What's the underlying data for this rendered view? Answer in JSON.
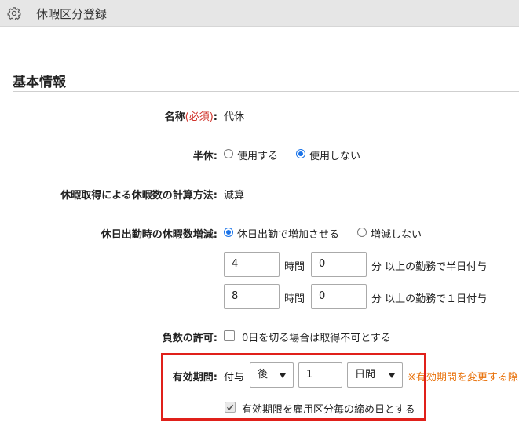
{
  "header": {
    "title": "休暇区分登録",
    "icon": "gear-icon"
  },
  "section": {
    "title": "基本情報"
  },
  "fields": {
    "name": {
      "label": "名称",
      "required": "(必須)",
      "colon": ":",
      "value": "代休"
    },
    "half_day": {
      "label": "半休:",
      "options": [
        {
          "label": "使用する",
          "selected": false
        },
        {
          "label": "使用しない",
          "selected": true
        }
      ]
    },
    "calc_method": {
      "label": "休暇取得による休暇数の計算方法:",
      "value": "減算"
    },
    "holiday_work": {
      "label": "休日出勤時の休暇数増減:",
      "options": [
        {
          "label": "休日出勤で増加させる",
          "selected": true
        },
        {
          "label": "増減しない",
          "selected": false
        }
      ],
      "half_grant": {
        "hours": "4",
        "hours_unit": "時間",
        "minutes": "0",
        "suffix": "分 以上の勤務で半日付与"
      },
      "full_grant": {
        "hours": "8",
        "hours_unit": "時間",
        "minutes": "0",
        "suffix": "分 以上の勤務で１日付与"
      }
    },
    "negative": {
      "label": "負数の許可:",
      "checkbox_label": "0日を切る場合は取得不可とする",
      "checked": false
    },
    "validity": {
      "label": "有効期間:",
      "prefix": "付与",
      "direction": "後",
      "amount": "1",
      "unit": "日間",
      "note": "※有効期間を変更する際",
      "closing_checkbox_label": "有効期限を雇用区分毎の締め日とする",
      "closing_checked": true
    }
  },
  "colors": {
    "accent": "#1a73e8",
    "required": "#d0342c",
    "note": "#e8710a",
    "highlight": "#e0201a"
  }
}
